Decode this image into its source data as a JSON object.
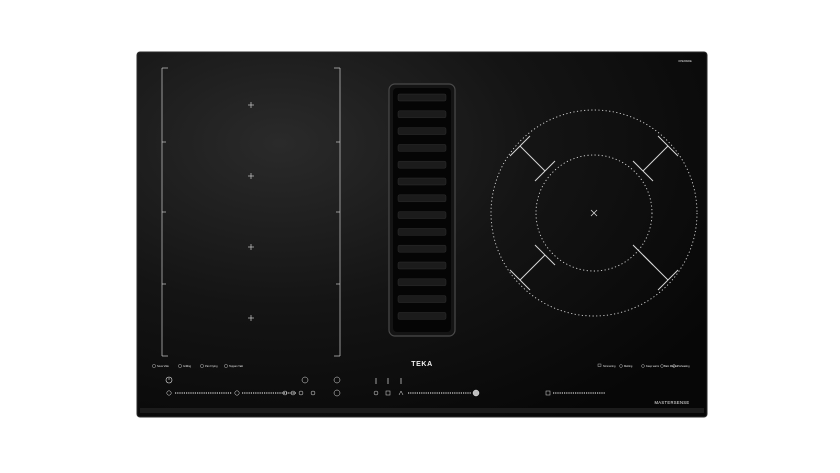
{
  "brand": {
    "logo_text": "TEKA",
    "series_text": "MASTERSENSE",
    "badge_text": "OPENSIDE"
  },
  "colors": {
    "glass": "#0a0a0a",
    "frame": "#2b2b2b",
    "lines": "#dcdcdc",
    "vent_slat": "#1a1a1a"
  },
  "left_zone": {
    "functions": [
      "Sous Vide",
      "Grilling",
      "Pan Frying",
      "Teppan Yaki"
    ]
  },
  "right_zone": {
    "functions": [
      "Simmering",
      "Melting",
      "Keep warm",
      "Bain Maries",
      "Preheating"
    ]
  },
  "controls": {
    "power_icon": "power-icon",
    "lock_icon": "lock-icon",
    "timer_icon": "timer-icon",
    "hood_icon": "hood-icon",
    "boost_icon": "boost-icon"
  }
}
